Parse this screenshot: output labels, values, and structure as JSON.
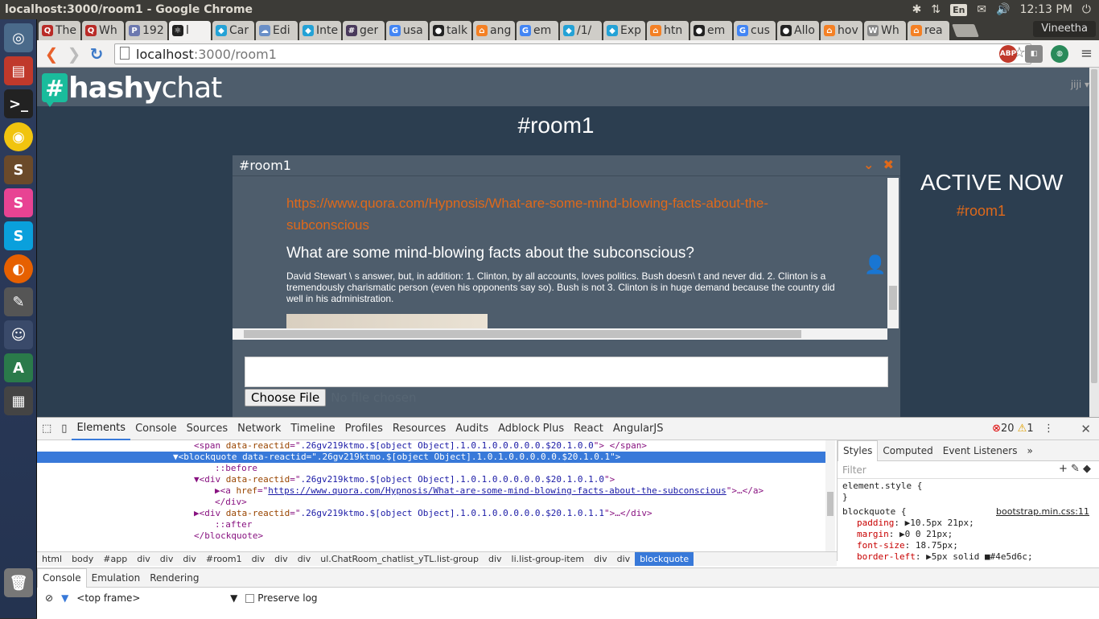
{
  "os": {
    "window_title": "localhost:3000/room1 - Google Chrome",
    "language": "En",
    "clock": "12:13 PM"
  },
  "browser": {
    "tabs": [
      {
        "label": "The",
        "icon": "quora-icon",
        "color": "#b92b27",
        "glyph": "Q"
      },
      {
        "label": "Wh",
        "icon": "quora-icon",
        "color": "#b92b27",
        "glyph": "Q"
      },
      {
        "label": "192",
        "icon": "phpmyadmin-icon",
        "color": "#6c78af",
        "glyph": "P"
      },
      {
        "label": "l",
        "icon": "react-icon",
        "color": "#222222",
        "glyph": "⚛"
      },
      {
        "label": "Car",
        "icon": "codepen-icon",
        "color": "#24a2d6",
        "glyph": "◆"
      },
      {
        "label": "Edi",
        "icon": "cloud-icon",
        "color": "#6a8fc7",
        "glyph": "☁"
      },
      {
        "label": "Inte",
        "icon": "codepen-icon",
        "color": "#24a2d6",
        "glyph": "◆"
      },
      {
        "label": "ger",
        "icon": "slack-icon",
        "color": "#4a3a5c",
        "glyph": "#"
      },
      {
        "label": "usa",
        "icon": "google-icon",
        "color": "#4285f4",
        "glyph": "G"
      },
      {
        "label": "talk",
        "icon": "github-icon",
        "color": "#222222",
        "glyph": "●"
      },
      {
        "label": "ang",
        "icon": "so-icon",
        "color": "#f48024",
        "glyph": "⌂"
      },
      {
        "label": "em",
        "icon": "google-icon",
        "color": "#4285f4",
        "glyph": "G"
      },
      {
        "label": "/1/",
        "icon": "codepen-icon",
        "color": "#24a2d6",
        "glyph": "◆"
      },
      {
        "label": "Exp",
        "icon": "codepen-icon",
        "color": "#24a2d6",
        "glyph": "◆"
      },
      {
        "label": "htn",
        "icon": "so-icon",
        "color": "#f48024",
        "glyph": "⌂"
      },
      {
        "label": "em",
        "icon": "github-icon",
        "color": "#222222",
        "glyph": "●"
      },
      {
        "label": "cus",
        "icon": "google-icon",
        "color": "#4285f4",
        "glyph": "G"
      },
      {
        "label": "Allo",
        "icon": "github-icon",
        "color": "#222222",
        "glyph": "●"
      },
      {
        "label": "hov",
        "icon": "so-icon",
        "color": "#f48024",
        "glyph": "⌂"
      },
      {
        "label": "Wh",
        "icon": "wiki-icon",
        "color": "#888888",
        "glyph": "W"
      },
      {
        "label": "rea",
        "icon": "so-icon",
        "color": "#f48024",
        "glyph": "⌂"
      }
    ],
    "active_tab_index": 3,
    "profile": "Vineetha",
    "url_host": "localhost",
    "url_path": ":3000/room1",
    "ext_abp": "ABP",
    "ext_abp_count": "1",
    "ext_react_count": "0"
  },
  "app": {
    "brand_hash": "#",
    "brand_bold": "hashy",
    "brand_light": "chat",
    "user": "jiji ▾",
    "room_title": "#room1",
    "panel_title": "#room1",
    "message": {
      "link": "https://www.quora.com/Hypnosis/What-are-some-mind-blowing-facts-about-the-subconscious",
      "title": "What are some mind-blowing facts about the subconscious?",
      "text": "David Stewart \\ s answer, but, in addition: 1. Clinton, by all accounts, loves politics. Bush doesn\\ t and never did. 2. Clinton is a tremendously charismatic person (even his opponents say so). Bush is not 3. Clinton is in huge demand because the country did well in his administration."
    },
    "file_button": "Choose File",
    "file_status": "No file chosen",
    "active_now": "ACTIVE NOW",
    "active_room": "#room1",
    "colors": {
      "accent": "#df691a",
      "bg": "#2c3e50",
      "panel": "#4e5d6c",
      "brand": "#1abc9c"
    }
  },
  "devtools": {
    "tabs": [
      "Elements",
      "Console",
      "Sources",
      "Network",
      "Timeline",
      "Profiles",
      "Resources",
      "Audits",
      "Adblock Plus",
      "React",
      "AngularJS"
    ],
    "errors": "20",
    "warnings": "1",
    "dom_lines": [
      {
        "indent": 15,
        "html": "<span class=\"ps\">&lt;span</span> <span class=\"at\">data-reactid</span>=\"<span class=\"av\">.26gv219ktmo.$[object Object].1.0.1.0.0.0.0.0.$20.1.0.0</span>\"<span class=\"ps\">&gt; &lt;/span&gt;</span>"
      },
      {
        "indent": 13,
        "sel": true,
        "html": "▼&lt;blockquote <span class=\"at\">data-reactid</span>=\"<span class=\"av\">.26gv219ktmo.$[object Object].1.0.1.0.0.0.0.0.$20.1.0.1</span>\"&gt;"
      },
      {
        "indent": 17,
        "html": "::before"
      },
      {
        "indent": 15,
        "html": "▼&lt;div <span class=\"at\">data-reactid</span>=\"<span class=\"av\">.26gv219ktmo.$[object Object].1.0.1.0.0.0.0.0.$20.1.0.1.0</span>\"&gt;"
      },
      {
        "indent": 17,
        "html": "▶&lt;a <span class=\"at\">href</span>=\"<span class=\"lk\">https://www.quora.com/Hypnosis/What-are-some-mind-blowing-facts-about-the-subconscious</span>\"&gt;…&lt;/a&gt;"
      },
      {
        "indent": 17,
        "html": "&lt;/div&gt;"
      },
      {
        "indent": 15,
        "html": "▶&lt;div <span class=\"at\">data-reactid</span>=\"<span class=\"av\">.26gv219ktmo.$[object Object].1.0.1.0.0.0.0.0.$20.1.0.1.1</span>\"&gt;…&lt;/div&gt;"
      },
      {
        "indent": 17,
        "html": "::after"
      },
      {
        "indent": 15,
        "html": "&lt;/blockquote&gt;"
      }
    ],
    "breadcrumbs": [
      "html",
      "body",
      "#app",
      "div",
      "div",
      "div",
      "#room1",
      "div",
      "div",
      "div",
      "ul.ChatRoom_chatlist_yTL.list-group",
      "div",
      "li.list-group-item",
      "div",
      "div",
      "blockquote"
    ],
    "styles_tabs": [
      "Styles",
      "Computed",
      "Event Listeners",
      "»"
    ],
    "filter_placeholder": "Filter",
    "element_style": "element.style {",
    "rule_selector": "blockquote {",
    "rule_source": "bootstrap.min.css:11",
    "rule_props": [
      {
        "name": "padding",
        "value": "▶10.5px 21px;"
      },
      {
        "name": "margin",
        "value": "▶0 0 21px;"
      },
      {
        "name": "font-size",
        "value": "18.75px;"
      },
      {
        "name": "border-left",
        "value": "▶5px solid ■#4e5d6c;"
      }
    ],
    "drawer_tabs": [
      "Console",
      "Emulation",
      "Rendering"
    ],
    "frame_select": "<top frame>",
    "preserve_log": "Preserve log"
  }
}
